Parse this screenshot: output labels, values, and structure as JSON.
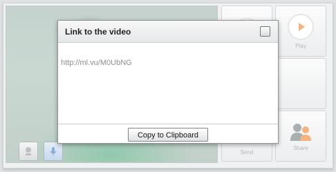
{
  "dialog": {
    "title": "Link to the video",
    "link_url": "http://ml.vu/M0UbNG",
    "copy_button_label": "Copy to Clipboard"
  },
  "controls": {
    "play_label": "Play",
    "send_label": "Send",
    "share_label": "Share"
  },
  "icons": {
    "record": "record-icon",
    "play": "play-icon",
    "share": "share-icon",
    "camera": "camera-icon",
    "microphone": "microphone-icon"
  },
  "colors": {
    "accent": "#f08a3c"
  }
}
